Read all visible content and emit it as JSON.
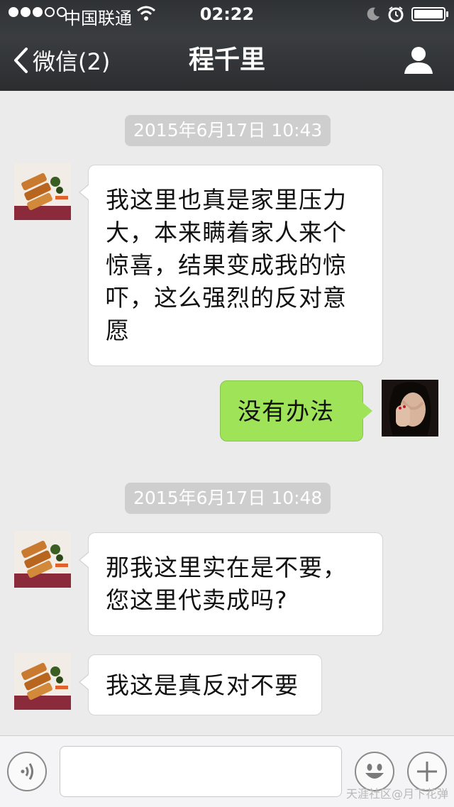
{
  "status_bar": {
    "carrier": "中国联通",
    "time": "02:22"
  },
  "nav": {
    "back_label": "微信(2)",
    "title": "程千里"
  },
  "messages": [
    {
      "type": "timestamp",
      "text": "2015年6月17日 10:43"
    },
    {
      "type": "incoming",
      "text": "我这里也真是家里压力大，本来瞒着家人来个惊喜，结果变成我的惊吓，这么强烈的反对意愿"
    },
    {
      "type": "outgoing",
      "text": "没有办法"
    },
    {
      "type": "timestamp",
      "text": "2015年6月17日 10:48"
    },
    {
      "type": "incoming",
      "text": "那我这里实在是不要，您这里代卖成吗?"
    },
    {
      "type": "incoming",
      "text": "我这是真反对不要"
    }
  ],
  "input": {
    "value": "",
    "placeholder": ""
  },
  "watermark": "天涯社区@月下花弹",
  "colors": {
    "header_bg": "#2f3234",
    "outgoing_bubble": "#9fe358",
    "incoming_bubble": "#ffffff",
    "timestamp_bg": "#cecece",
    "chat_bg": "#ebebeb"
  },
  "icons": {
    "back": "chevron-left-icon",
    "profile": "person-icon",
    "voice": "voice-icon",
    "emoji": "smiley-icon",
    "more": "plus-icon"
  }
}
